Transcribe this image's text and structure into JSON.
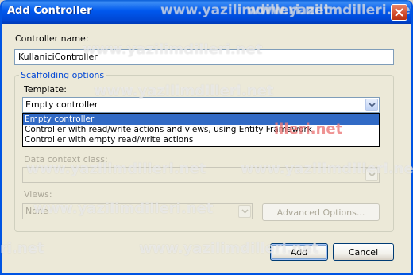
{
  "window": {
    "title": "Add Controller",
    "close_icon": "close-icon"
  },
  "controller_name": {
    "label": "Controller name:",
    "value": "KullaniciController"
  },
  "scaffolding": {
    "group_title": "Scaffolding options",
    "template_label": "Template:",
    "template_value": "Empty controller",
    "template_options": [
      "Empty controller",
      "Controller with read/write actions and views, using Entity Framework",
      "Controller with empty read/write actions"
    ],
    "data_context_label": "Data context class:",
    "data_context_value": "",
    "views_label": "Views:",
    "views_value": "None",
    "advanced_button": "Advanced Options..."
  },
  "buttons": {
    "add": "Add",
    "cancel": "Cancel"
  },
  "watermark": "www.yazilimdilleri.net",
  "watermark_short": "illeri.net",
  "watermark_edge": "ri.net",
  "colors": {
    "title_bar": "#0058ee",
    "selection": "#316ac5",
    "group_title": "#0046d5",
    "dialog_bg": "#ece9d8"
  }
}
